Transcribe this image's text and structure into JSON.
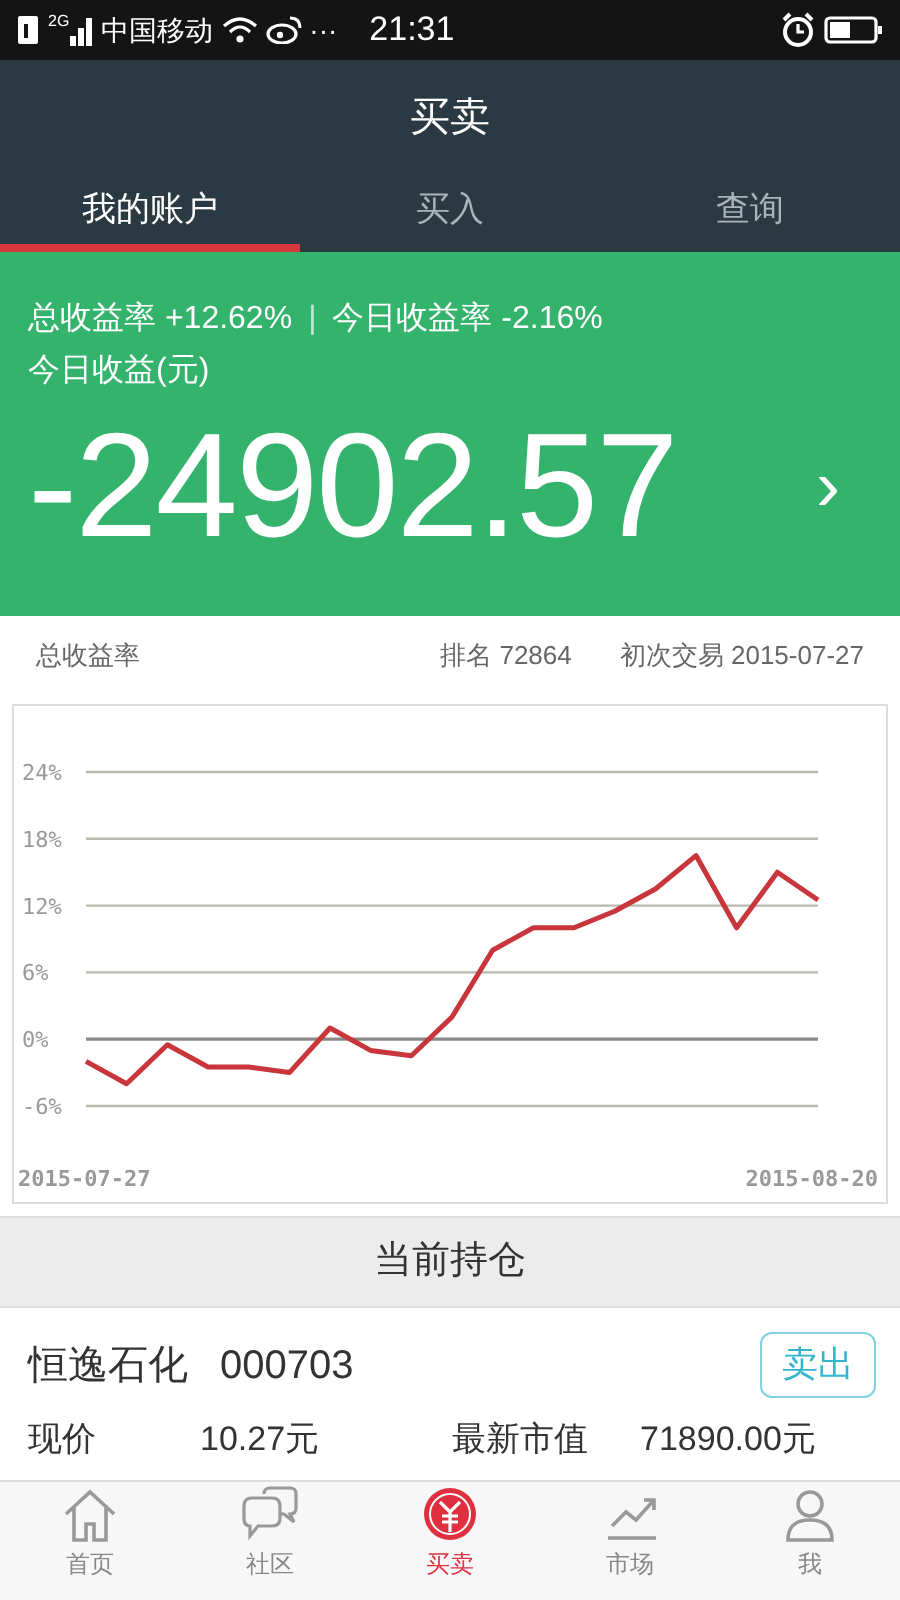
{
  "status_bar": {
    "network": "2G",
    "carrier": "中国移动",
    "more": "···",
    "time": "21:31"
  },
  "header": {
    "title": "买卖"
  },
  "tabs": [
    {
      "label": "我的账户",
      "selected": true
    },
    {
      "label": "买入",
      "selected": false
    },
    {
      "label": "查询",
      "selected": false
    }
  ],
  "summary": {
    "total_rate": "总收益率 +12.62%",
    "separator": "|",
    "today_rate": "今日收益率 -2.16%",
    "today_label": "今日收益(元)",
    "today_value": "-24902.57",
    "arrow": "›"
  },
  "info": {
    "label": "总收益率",
    "rank": "排名 72864",
    "first_trade": "初次交易 2015-07-27"
  },
  "chart": {
    "chart_data": {
      "type": "line",
      "grid": true,
      "categories": [
        "2015-07-27",
        null,
        null,
        null,
        null,
        null,
        null,
        null,
        null,
        null,
        null,
        null,
        null,
        null,
        null,
        null,
        null,
        null,
        "2015-08-20"
      ],
      "series": [
        {
          "color": "#c8353a",
          "values": [
            -2,
            -4,
            -0.5,
            -2.5,
            -2.5,
            -3,
            1,
            -1,
            -1.5,
            2,
            8,
            10,
            10,
            11.5,
            13.5,
            16.5,
            10,
            15,
            12.5
          ]
        }
      ],
      "ylim": [
        -6,
        24
      ],
      "yticks": [
        {
          "value": -6,
          "label": "-6%"
        },
        {
          "value": 0,
          "label": "0%"
        },
        {
          "value": 6,
          "label": "6%"
        },
        {
          "value": 12,
          "label": "12%"
        },
        {
          "value": 18,
          "label": "18%"
        },
        {
          "value": 24,
          "label": "24%"
        }
      ]
    }
  },
  "holdings": {
    "title": "当前持仓",
    "items": [
      {
        "name": "恒逸石化",
        "code": "000703",
        "action": "卖出",
        "fields": [
          {
            "label": "现价",
            "value": "10.27元"
          },
          {
            "label": "最新市值",
            "value": "71890.00元"
          }
        ]
      }
    ]
  },
  "bottom_nav": [
    {
      "kind": "home",
      "label": "首页",
      "selected": false
    },
    {
      "kind": "community",
      "label": "社区",
      "selected": false
    },
    {
      "kind": "trade",
      "label": "买卖",
      "selected": true
    },
    {
      "kind": "market",
      "label": "市场",
      "selected": false
    },
    {
      "kind": "me",
      "label": "我",
      "selected": false
    }
  ]
}
